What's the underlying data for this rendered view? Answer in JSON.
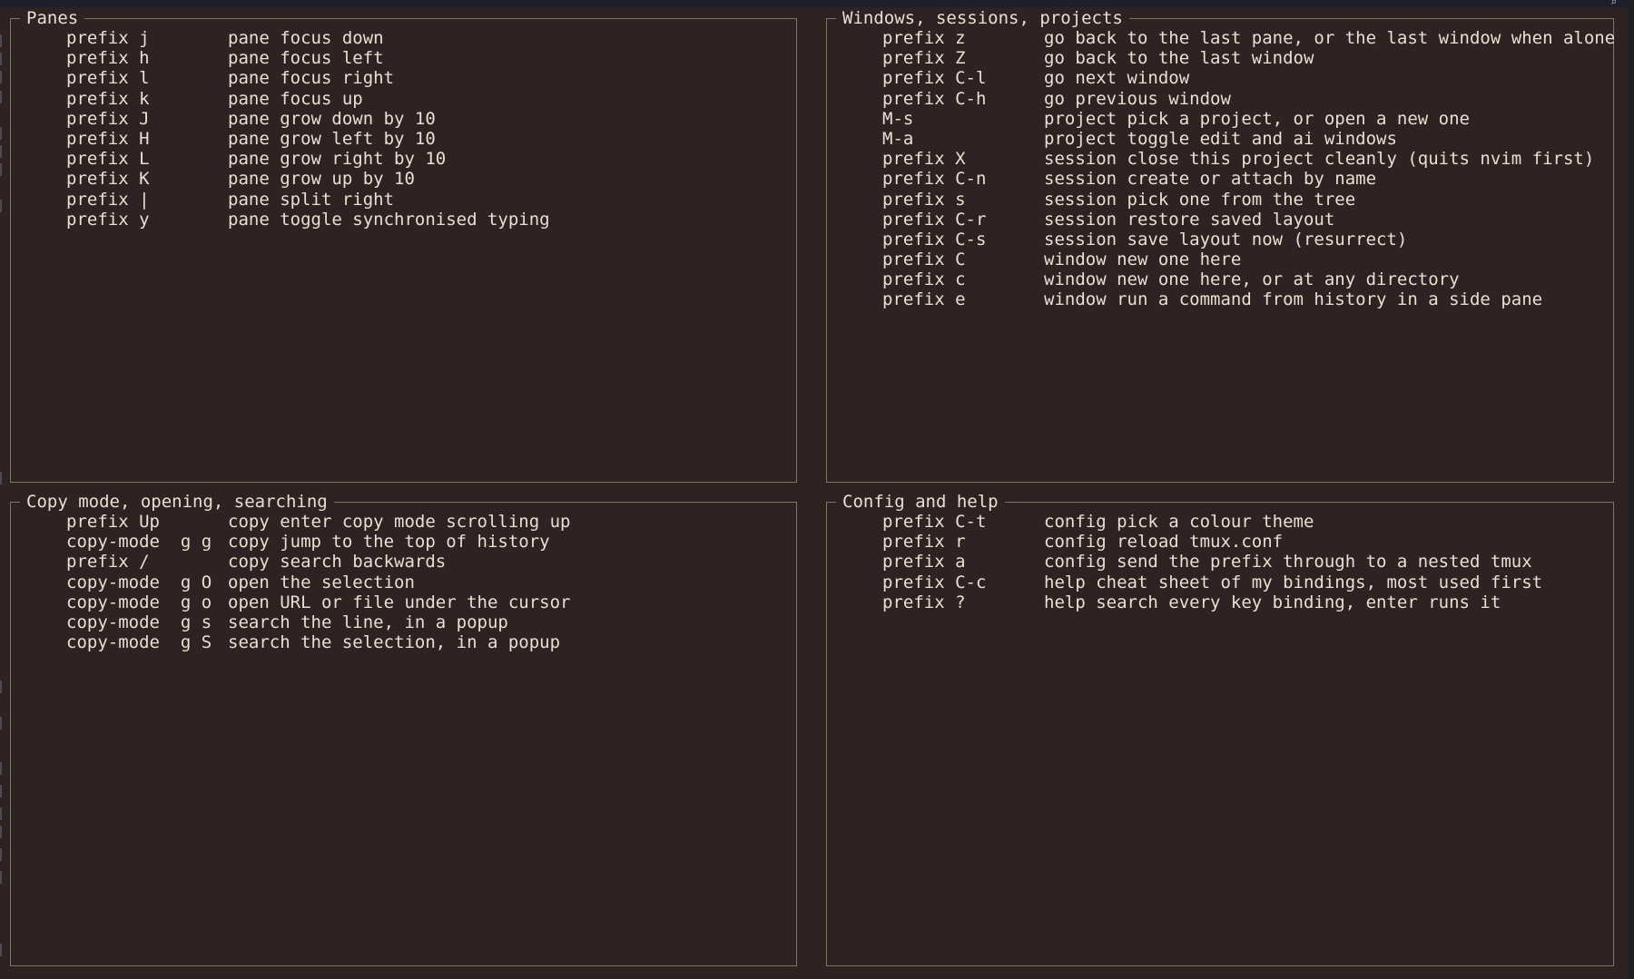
{
  "panels": {
    "panes": {
      "title": "Panes",
      "rows": [
        {
          "key": "prefix j",
          "desc": "pane focus down"
        },
        {
          "key": "prefix h",
          "desc": "pane focus left"
        },
        {
          "key": "prefix l",
          "desc": "pane focus right"
        },
        {
          "key": "prefix k",
          "desc": "pane focus up"
        },
        {
          "key": "prefix J",
          "desc": "pane grow down by 10"
        },
        {
          "key": "prefix H",
          "desc": "pane grow left by 10"
        },
        {
          "key": "prefix L",
          "desc": "pane grow right by 10"
        },
        {
          "key": "prefix K",
          "desc": "pane grow up by 10"
        },
        {
          "key": "prefix |",
          "desc": "pane split right"
        },
        {
          "key": "prefix y",
          "desc": "pane toggle synchronised typing"
        }
      ]
    },
    "windows": {
      "title": "Windows, sessions, projects",
      "rows": [
        {
          "key": "prefix z",
          "desc": "go back to the last pane, or the last window when alone"
        },
        {
          "key": "prefix Z",
          "desc": "go back to the last window"
        },
        {
          "key": "prefix C-l",
          "desc": "go next window"
        },
        {
          "key": "prefix C-h",
          "desc": "go previous window"
        },
        {
          "key": "M-s",
          "desc": "project pick a project, or open a new one"
        },
        {
          "key": "M-a",
          "desc": "project toggle edit and ai windows"
        },
        {
          "key": "prefix X",
          "desc": "session close this project cleanly (quits nvim first)"
        },
        {
          "key": "prefix C-n",
          "desc": "session create or attach by name"
        },
        {
          "key": "prefix s",
          "desc": "session pick one from the tree"
        },
        {
          "key": "prefix C-r",
          "desc": "session restore saved layout"
        },
        {
          "key": "prefix C-s",
          "desc": "session save layout now (resurrect)"
        },
        {
          "key": "prefix C",
          "desc": "window new one here"
        },
        {
          "key": "prefix c",
          "desc": "window new one here, or at any directory"
        },
        {
          "key": "prefix e",
          "desc": "window run a command from history in a side pane"
        }
      ]
    },
    "copy": {
      "title": "Copy mode, opening, searching",
      "rows": [
        {
          "key": "prefix Up",
          "desc": "copy enter copy mode scrolling up"
        },
        {
          "key": "copy-mode  g g",
          "desc": "copy jump to the top of history"
        },
        {
          "key": "prefix /",
          "desc": "copy search backwards"
        },
        {
          "key": "copy-mode  g O",
          "desc": "open the selection"
        },
        {
          "key": "copy-mode  g o",
          "desc": "open URL or file under the cursor"
        },
        {
          "key": "copy-mode  g s",
          "desc": "search the line, in a popup"
        },
        {
          "key": "copy-mode  g S",
          "desc": "search the selection, in a popup"
        }
      ]
    },
    "config": {
      "title": "Config and help",
      "rows": [
        {
          "key": "prefix C-t",
          "desc": "config pick a colour theme"
        },
        {
          "key": "prefix r",
          "desc": "config reload tmux.conf"
        },
        {
          "key": "prefix a",
          "desc": "config send the prefix through to a nested tmux"
        },
        {
          "key": "prefix C-c",
          "desc": "help cheat sheet of my bindings, most used first"
        },
        {
          "key": "prefix ?",
          "desc": "help search every key binding, enter runs it"
        }
      ]
    }
  },
  "colors": {
    "background": "#2c2322",
    "text": "#e8e0d2",
    "border": "#7f7766"
  },
  "icons": {
    "topbar": "search-icon"
  }
}
